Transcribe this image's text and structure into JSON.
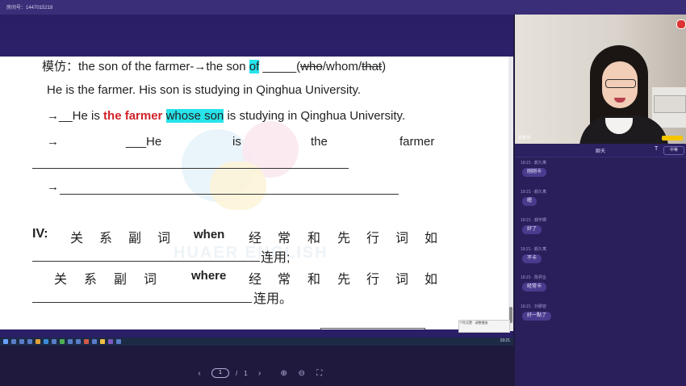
{
  "header": {
    "room_label": "房间号：1447015218"
  },
  "slide": {
    "line1": {
      "prefix": "模仿：the son of the farmer-→the son ",
      "of": "of",
      "blank": " _____(",
      "who": "who",
      "slash1": "/whom/",
      "that": "that",
      "close": ")"
    },
    "line2": "He is the farmer. His son is studying in Qinghua University.",
    "line3": {
      "arrow": "→__He is ",
      "red": "the farmer",
      "hl": "whose son",
      "rest": " is studying in Qinghua University."
    },
    "line4": {
      "arrow": "→",
      "w1": "___He",
      "w2": "is",
      "w3": "the",
      "w4": "farmer"
    },
    "line5_arrow": "→",
    "section4": {
      "label": "IV:",
      "c1": "关",
      "c2": "系",
      "c3": "副",
      "c4": "词",
      "when": "when",
      "c5": "经",
      "c6": "常",
      "c7": "和",
      "c8": "先",
      "c9": "行",
      "c10": "词",
      "c11": "如",
      "end1": "连用;",
      "d1": "关",
      "d2": "系",
      "d3": "副",
      "d4": "词",
      "where": "where",
      "d5": "经",
      "d6": "常",
      "d7": "和",
      "d8": "先",
      "d9": "行",
      "d10": "词",
      "d11": "如",
      "end2": "连用。"
    },
    "watermark": "HUAER ENGLISH",
    "mini_toolbar": "个性设置 · 调整播放"
  },
  "taskbar": {
    "clock": "19:21"
  },
  "pager": {
    "current": "1",
    "separator": "/",
    "total": "1"
  },
  "video": {
    "name": "郭老师"
  },
  "chat_panel": {
    "title": "聊天",
    "font_icon": "T",
    "language": "中等",
    "messages": [
      {
        "time": "19:21",
        "user": "颜久寓",
        "text": "刚刚卡"
      },
      {
        "time": "19:21",
        "user": "颜久寓",
        "text": "嗯"
      },
      {
        "time": "19:21",
        "user": "郝宇卿",
        "text": "好了"
      },
      {
        "time": "19:21",
        "user": "颜久寓",
        "text": "不卡"
      },
      {
        "time": "19:21",
        "user": "陈羿企",
        "text": "经常卡"
      },
      {
        "time": "19:21",
        "user": "刘穆容",
        "text": "好一點了"
      }
    ]
  }
}
